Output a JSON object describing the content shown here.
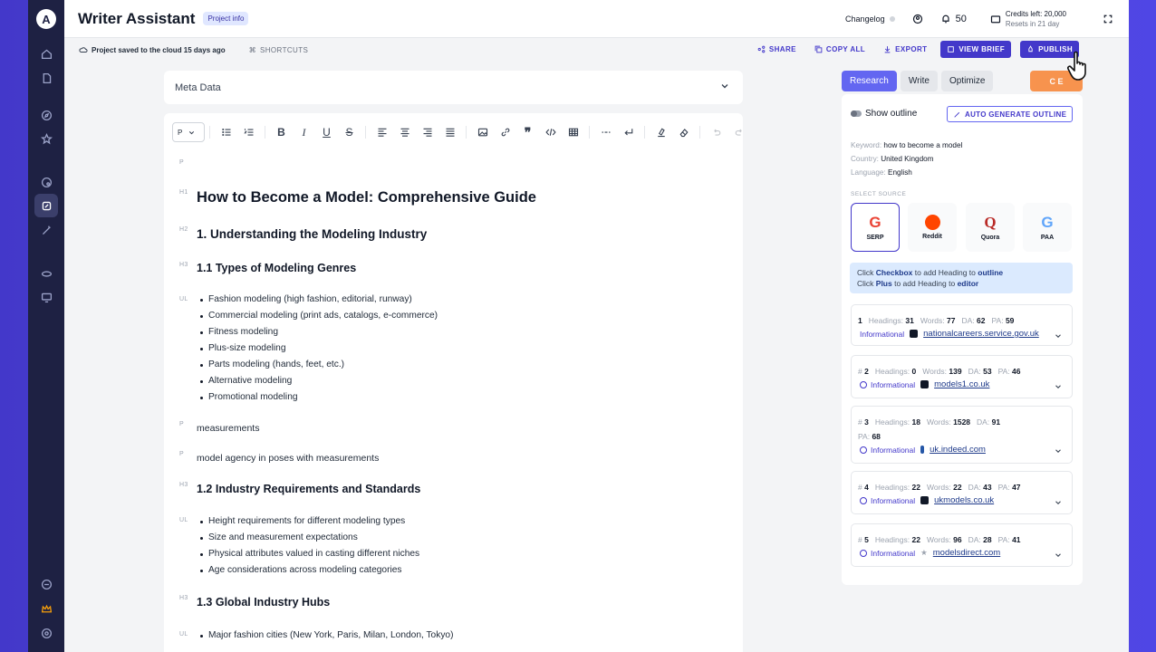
{
  "app": {
    "title": "Writer Assistant",
    "project_badge": "Project info"
  },
  "topbar": {
    "changelog": "Changelog",
    "notifications": "50",
    "credits_line1": "Credits left: 20,000",
    "credits_line2": "Resets in 21 day"
  },
  "subbar": {
    "saved": "Project saved to the cloud 15 days ago",
    "shortcuts": "SHORTCUTS",
    "share": "SHARE",
    "copy_all": "COPY ALL",
    "export": "EXPORT",
    "view_brief": "VIEW BRIEF",
    "publish": "PUBLISH"
  },
  "meta": {
    "label": "Meta Data"
  },
  "toolbar": {
    "paragraph_select": "P"
  },
  "doc": {
    "tags": {
      "p": "P",
      "h1": "H1",
      "h2": "H2",
      "h3": "H3",
      "ul": "UL"
    },
    "h1": "How to Become a Model: Comprehensive Guide",
    "h2_1": "1. Understanding the Modeling Industry",
    "h3_1": "1.1 Types of Modeling Genres",
    "list1": [
      "Fashion modeling (high fashion, editorial, runway)",
      "Commercial modeling (print ads, catalogs, e-commerce)",
      "Fitness modeling",
      "Plus-size modeling",
      "Parts modeling (hands, feet, etc.)",
      "Alternative modeling",
      "Promotional modeling"
    ],
    "p1": "measurements",
    "p2": "model agency in poses with measurements",
    "h3_2": "1.2 Industry Requirements and Standards",
    "list2": [
      "Height requirements for different modeling types",
      "Size and measurement expectations",
      "Physical attributes valued in casting different niches",
      "Age considerations across modeling categories"
    ],
    "h3_3": "1.3 Global Industry Hubs",
    "list3": [
      "Major fashion cities (New York, Paris, Milan, London, Tokyo)"
    ]
  },
  "panel": {
    "tabs": [
      "Research",
      "Write",
      "Optimize"
    ],
    "create_btn": "C     E",
    "show_outline": "Show outline",
    "auto_generate": "AUTO GENERATE OUTLINE",
    "keyword_label": "Keyword:",
    "keyword": "how to become a model",
    "country_label": "Country:",
    "country": "United Kingdom",
    "language_label": "Language:",
    "language": "English",
    "select_source": "SELECT SOURCE",
    "sources": [
      "SERP",
      "Reddit",
      "Quora",
      "PAA"
    ],
    "hint1_pre": "Click ",
    "hint1_bold": "Checkbox",
    "hint1_mid": " to add Heading to ",
    "hint1_end": "outline",
    "hint2_pre": "Click ",
    "hint2_bold": "Plus",
    "hint2_mid": " to add Heading to ",
    "hint2_end": "editor",
    "labels": {
      "headings": "Headings:",
      "words": "Words:",
      "da": "DA:",
      "pa": "PA:",
      "informational": "Informational"
    },
    "results": [
      {
        "rank": "1",
        "headings": "31",
        "words": "77",
        "da": "62",
        "pa": "59",
        "url": "nationalcareers.service.gov.uk"
      },
      {
        "rank": "2",
        "headings": "0",
        "words": "139",
        "da": "53",
        "pa": "46",
        "url": "models1.co.uk"
      },
      {
        "rank": "3",
        "headings": "18",
        "words": "1528",
        "da": "91",
        "pa": "68",
        "url": "uk.indeed.com"
      },
      {
        "rank": "4",
        "headings": "22",
        "words": "22",
        "da": "43",
        "pa": "47",
        "url": "ukmodels.co.uk"
      },
      {
        "rank": "5",
        "headings": "22",
        "words": "96",
        "da": "28",
        "pa": "41",
        "url": "modelsdirect.com"
      }
    ]
  },
  "colors": {
    "accent": "#4338ca",
    "rail": "#1e2143",
    "background": "#5b50d6",
    "create": "#f97316"
  }
}
